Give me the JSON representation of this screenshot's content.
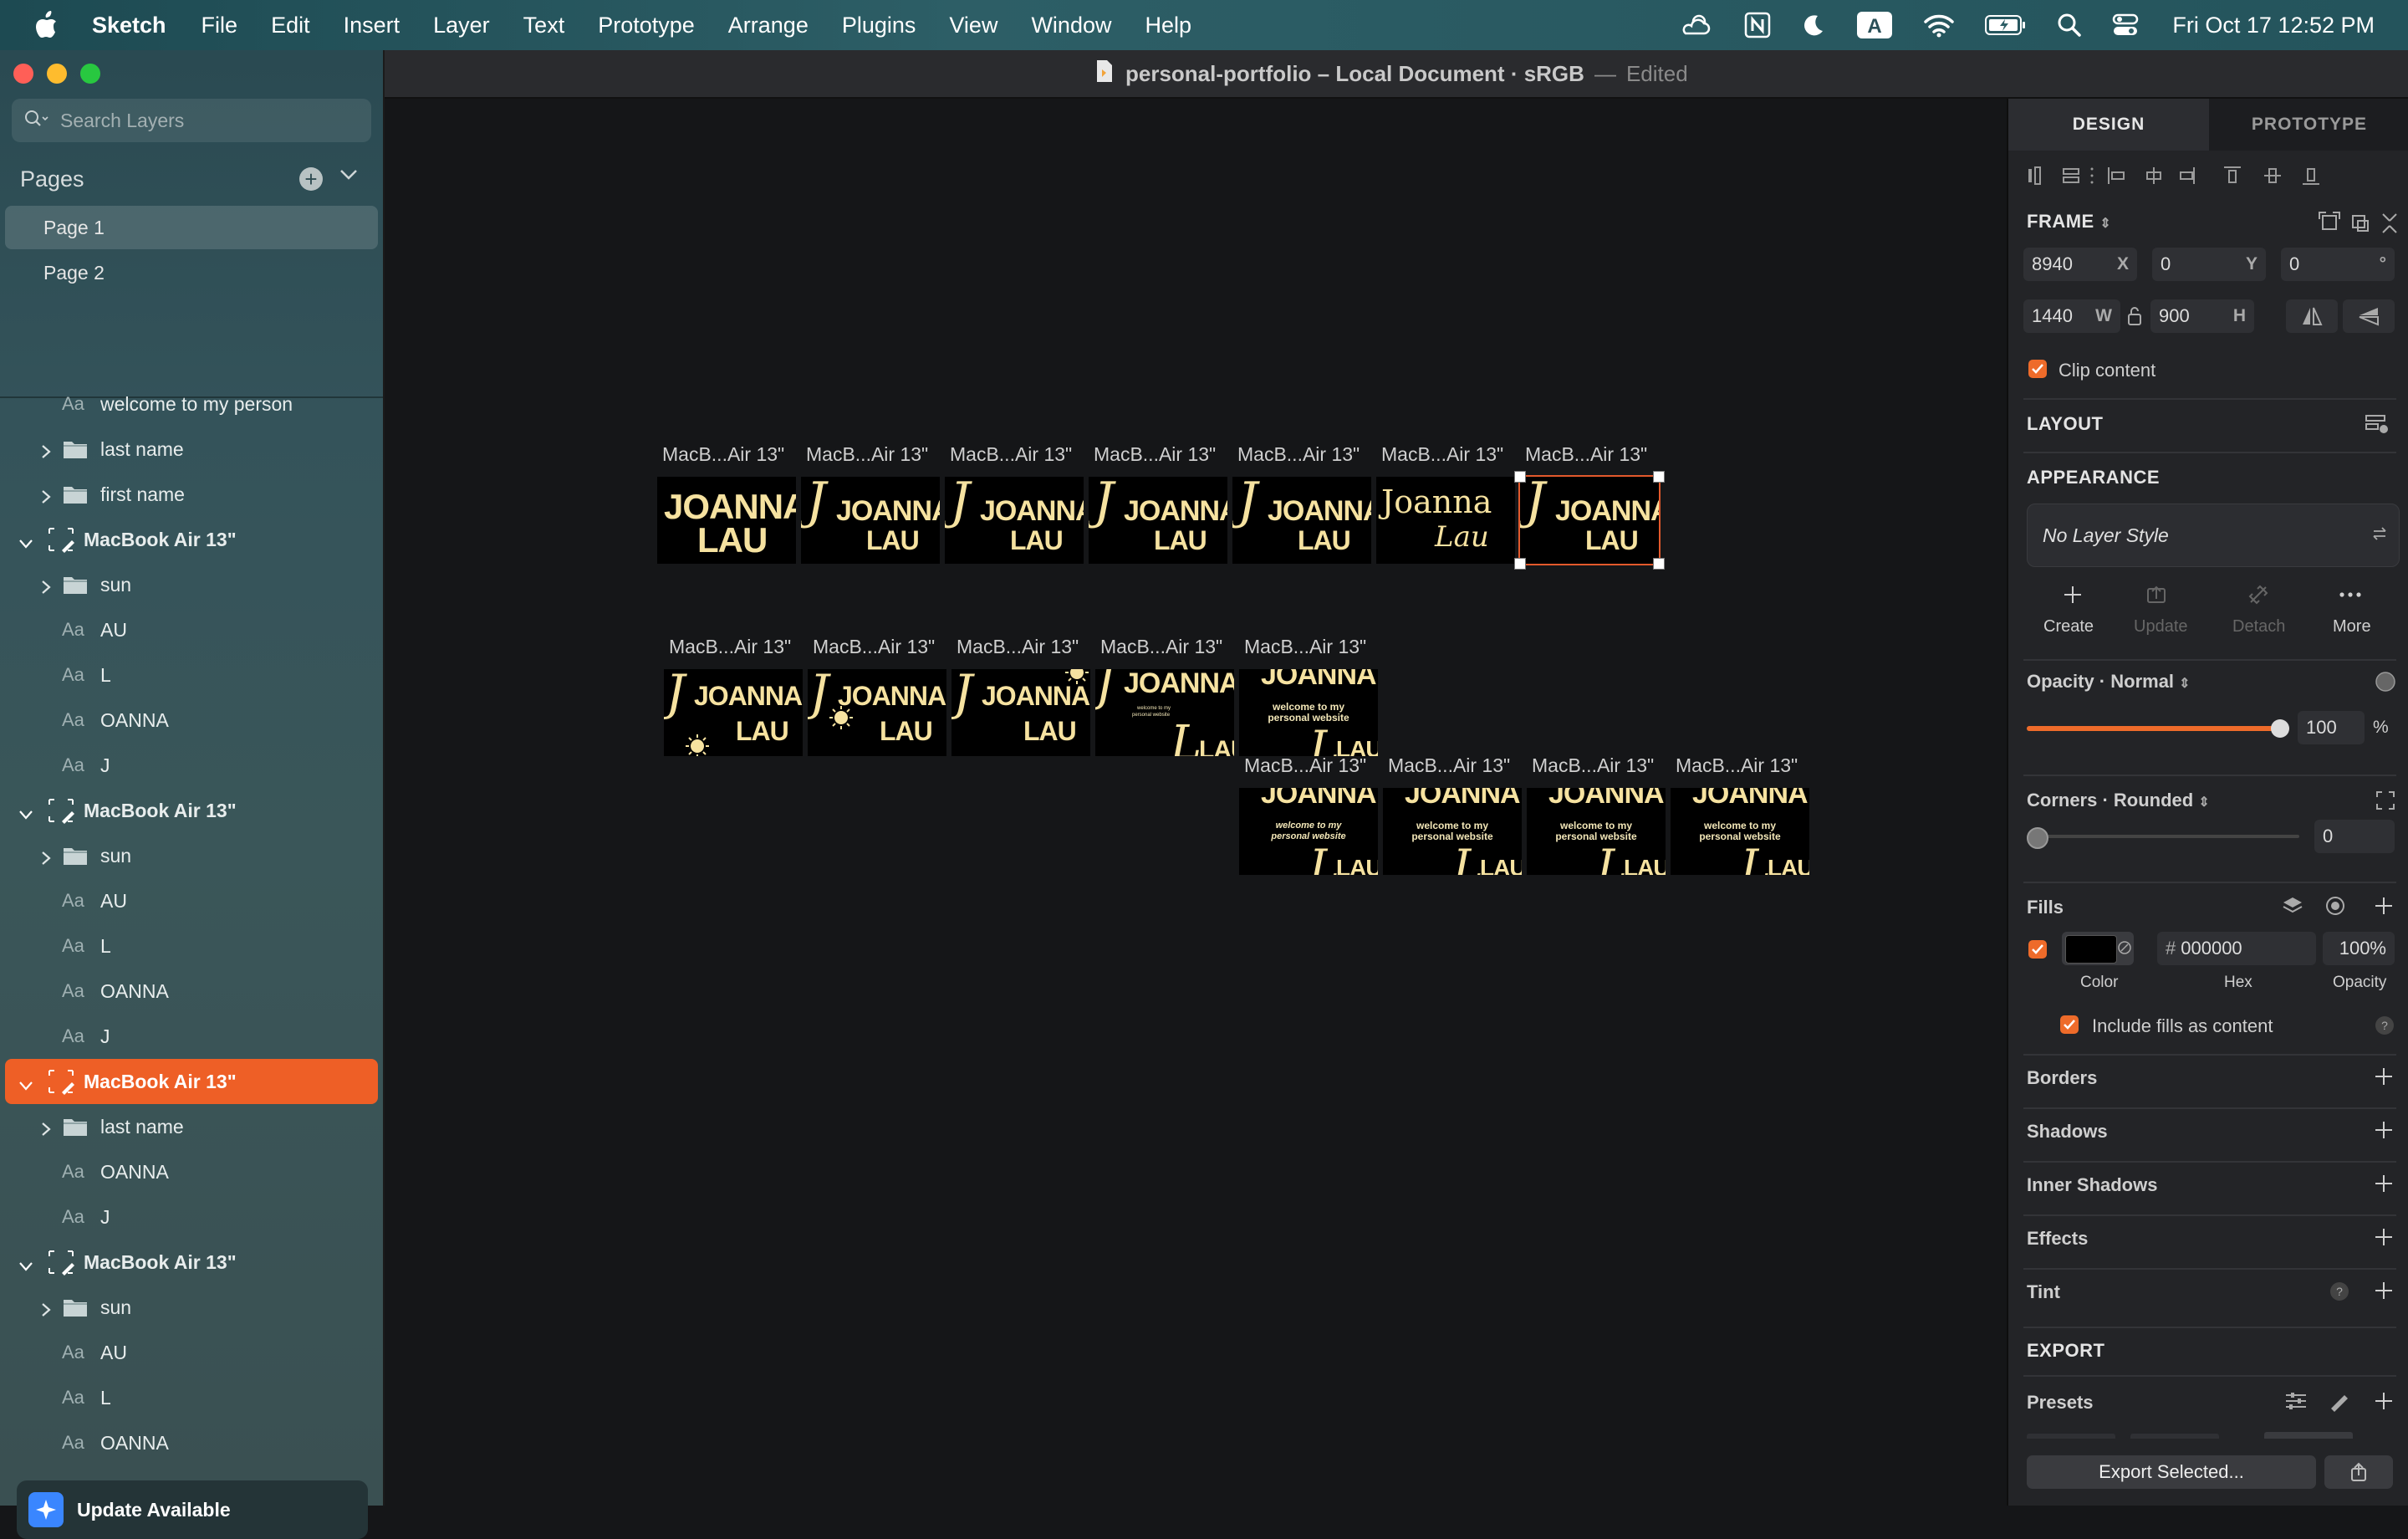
{
  "menubar": {
    "app_name": "Sketch",
    "menus": [
      "File",
      "Edit",
      "Insert",
      "Layer",
      "Text",
      "Prototype",
      "Arrange",
      "Plugins",
      "View",
      "Window",
      "Help"
    ],
    "input_source": "A",
    "clock": "Fri Oct 17  12:52 PM"
  },
  "window": {
    "title": "personal-portfolio – Local Document · sRGB",
    "separator": "—",
    "status": "Edited"
  },
  "sidebar": {
    "search_placeholder": "Search Layers",
    "pages_label": "Pages",
    "pages": [
      "Page 1",
      "Page 2"
    ],
    "layers": [
      {
        "type": "text",
        "label": "welcome to my person"
      },
      {
        "type": "folder",
        "label": "last name"
      },
      {
        "type": "folder",
        "label": "first name"
      },
      {
        "type": "artboard",
        "label": "MacBook Air 13\""
      },
      {
        "type": "folder",
        "label": "sun"
      },
      {
        "type": "text",
        "label": "AU"
      },
      {
        "type": "text",
        "label": "L"
      },
      {
        "type": "text",
        "label": "OANNA"
      },
      {
        "type": "text",
        "label": "J"
      },
      {
        "type": "artboard",
        "label": "MacBook Air 13\""
      },
      {
        "type": "folder",
        "label": "sun"
      },
      {
        "type": "text",
        "label": "AU"
      },
      {
        "type": "text",
        "label": "L"
      },
      {
        "type": "text",
        "label": "OANNA"
      },
      {
        "type": "text",
        "label": "J"
      },
      {
        "type": "artboard",
        "label": "MacBook Air 13\"",
        "selected": true
      },
      {
        "type": "folder",
        "label": "last name"
      },
      {
        "type": "text",
        "label": "OANNA"
      },
      {
        "type": "text",
        "label": "J"
      },
      {
        "type": "artboard",
        "label": "MacBook Air 13\""
      },
      {
        "type": "folder",
        "label": "sun"
      },
      {
        "type": "text",
        "label": "AU"
      },
      {
        "type": "text",
        "label": "L"
      },
      {
        "type": "text",
        "label": "OANNA"
      }
    ],
    "text_icon": "Aa",
    "update_label": "Update Available",
    "peek_label": "MacBook Air 13\""
  },
  "canvas": {
    "artboard_label": "MacB...Air 13\"",
    "first_name": "JOANNA",
    "last_name": "LAU",
    "script_first": "Joanna",
    "script_last": "Lau",
    "welcome_line1": "welcome to my",
    "welcome_line2": "personal website"
  },
  "inspector": {
    "tabs": [
      "DESIGN",
      "PROTOTYPE"
    ],
    "frame_label": "FRAME",
    "x": "8940",
    "x_unit": "X",
    "y": "0",
    "y_unit": "Y",
    "rotation": "0",
    "rotation_unit": "°",
    "w": "1440",
    "w_unit": "W",
    "h": "900",
    "h_unit": "H",
    "clip_content": "Clip content",
    "layout_label": "LAYOUT",
    "appearance_label": "APPEARANCE",
    "layer_style": "No Layer Style",
    "style_actions": [
      "Create",
      "Update",
      "Detach",
      "More"
    ],
    "opacity_label": "Opacity · Normal",
    "opacity_value": "100",
    "opacity_unit": "%",
    "opacity_fraction": 1.0,
    "corners_label": "Corners · Rounded",
    "corners_value": "0",
    "fills_label": "Fills",
    "fill_hash": "#",
    "fill_hex": "000000",
    "fill_opacity": "100%",
    "fill_sublabels": [
      "Color",
      "Hex",
      "Opacity"
    ],
    "include_fills": "Include fills as content",
    "sections": [
      "Borders",
      "Shadows",
      "Inner Shadows",
      "Effects",
      "Tint"
    ],
    "export_label": "EXPORT",
    "presets_label": "Presets",
    "export_button": "Export Selected...",
    "colors": {
      "accent": "#ee6b2a",
      "selected_row": "#ee5f26",
      "name_gold": "#f6e2a0"
    }
  }
}
